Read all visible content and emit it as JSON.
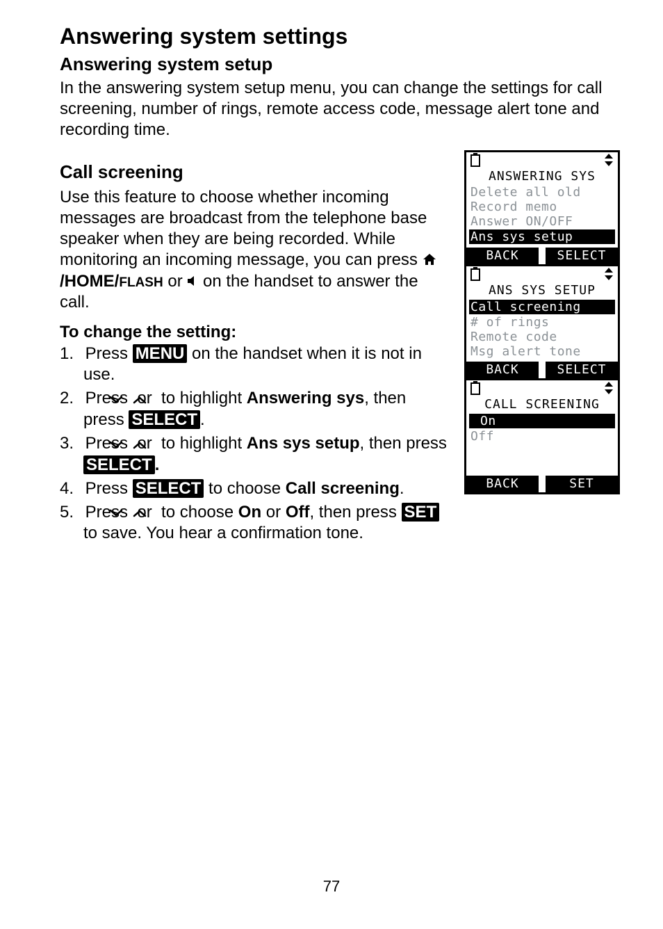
{
  "page_number": "77",
  "h1": "Answering system settings",
  "h2": "Answering system setup",
  "intro": "In the answering system setup menu, you can change the settings for call screening, number of rings, remote access code, message alert tone and recording time.",
  "h3": "Call screening",
  "cs_para_a": "Use this feature to choose whether incoming messages are broadcast from the telephone base speaker when they are being recorded. While monitoring an incoming message, you can press ",
  "cs_home": "/HOME/",
  "cs_flash": "FLASH",
  "cs_para_b": " or ",
  "cs_para_c": " on the handset to answer the call.",
  "h4": "To change the setting:",
  "steps": {
    "s1a": "Press ",
    "s1_menu": "MENU",
    "s1b": " on the handset when it is not in use.",
    "s2a": "Press ",
    "s2b": " or ",
    "s2c": " to highlight ",
    "s2_target": "Answering sys",
    "s2d": ", then press ",
    "s2_select": "SELECT",
    "s2e": ".",
    "s3a": "Press ",
    "s3b": " or ",
    "s3c": " to highlight ",
    "s3_target": "Ans sys setup",
    "s3d": ", then press ",
    "s3_select": "SELECT",
    "s3e": ".",
    "s4a": "Press ",
    "s4_select": "SELECT",
    "s4b": " to choose ",
    "s4_target": "Call screening",
    "s4c": ".",
    "s5a": "Press ",
    "s5b": " or ",
    "s5c": " to choose ",
    "s5_on": "On",
    "s5d": " or ",
    "s5_off": "Off",
    "s5e": ", then press ",
    "s5_set": "SET",
    "s5f": " to save. You hear a confirmation tone."
  },
  "screens": [
    {
      "title": "ANSWERING SYS",
      "rows": [
        {
          "text": "Delete all old",
          "hl": false
        },
        {
          "text": "Record memo",
          "hl": false
        },
        {
          "text": "Answer ON/OFF",
          "hl": false
        },
        {
          "text": "Ans sys setup",
          "hl": true
        }
      ],
      "left_btn": "BACK",
      "right_btn": "SELECT"
    },
    {
      "title": "ANS SYS SETUP",
      "rows": [
        {
          "text": "Call screening",
          "hl": true
        },
        {
          "text": "# of rings",
          "hl": false
        },
        {
          "text": "Remote code",
          "hl": false
        },
        {
          "text": "Msg alert tone",
          "hl": false
        }
      ],
      "left_btn": "BACK",
      "right_btn": "SELECT"
    },
    {
      "title": "CALL SCREENING",
      "rows": [
        {
          "text": "On",
          "hl": true,
          "check": true
        },
        {
          "text": " Off",
          "hl": false
        }
      ],
      "left_btn": "BACK",
      "right_btn": "SET"
    }
  ]
}
